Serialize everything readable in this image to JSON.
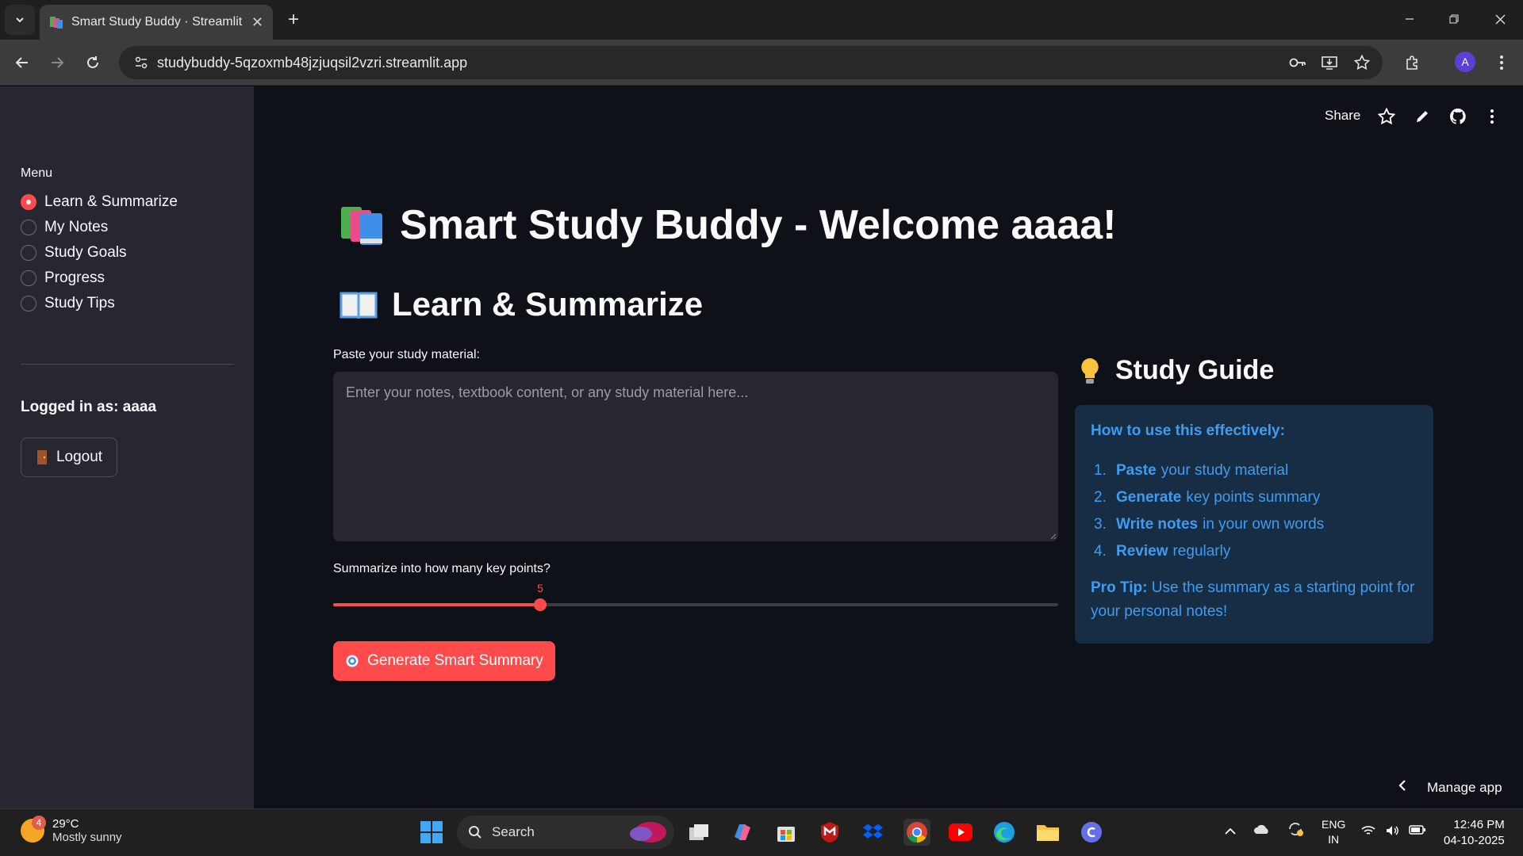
{
  "browser": {
    "tab_title": "Smart Study Buddy · Streamlit",
    "tab_close": "✕",
    "new_tab": "+",
    "url": "studybuddy-5qzoxmb48jzjuqsil2vzri.streamlit.app",
    "profile_initial": "A"
  },
  "sidebar": {
    "menu_label": "Menu",
    "items": [
      {
        "label": "Learn & Summarize",
        "selected": true
      },
      {
        "label": "My Notes",
        "selected": false
      },
      {
        "label": "Study Goals",
        "selected": false
      },
      {
        "label": "Progress",
        "selected": false
      },
      {
        "label": "Study Tips",
        "selected": false
      }
    ],
    "logged_in_prefix": "Logged in as:",
    "username": "aaaa",
    "logout_label": "Logout"
  },
  "header": {
    "share_label": "Share"
  },
  "main": {
    "title": "Smart Study Buddy - Welcome aaaa!",
    "section_title": "Learn & Summarize",
    "material_label": "Paste your study material:",
    "material_placeholder": "Enter your notes, textbook content, or any study material here...",
    "slider_label": "Summarize into how many key points?",
    "slider_value": "5",
    "slider_fraction": 0.2857,
    "generate_label": "Generate Smart Summary"
  },
  "guide": {
    "title": "Study Guide",
    "how_to": "How to use this effectively:",
    "steps": [
      {
        "num": "1.",
        "bold": "Paste",
        "rest": "your study material"
      },
      {
        "num": "2.",
        "bold": "Generate",
        "rest": "key points summary"
      },
      {
        "num": "3.",
        "bold": "Write notes",
        "rest": "in your own words"
      },
      {
        "num": "4.",
        "bold": "Review",
        "rest": "regularly"
      }
    ],
    "tip_bold": "Pro Tip:",
    "tip_text": "Use the summary as a starting point for your personal notes!"
  },
  "manage_app": "Manage app",
  "taskbar": {
    "weather_badge": "4",
    "temperature": "29°C",
    "condition": "Mostly sunny",
    "search_label": "Search",
    "lang_top": "ENG",
    "lang_bottom": "IN",
    "time": "12:46 PM",
    "date": "04-10-2025"
  },
  "colors": {
    "accent": "#ff4b4b",
    "info_bg": "#172d43",
    "info_text": "#3d9df3",
    "sidebar_bg": "#262730",
    "main_bg": "#0e1117"
  }
}
